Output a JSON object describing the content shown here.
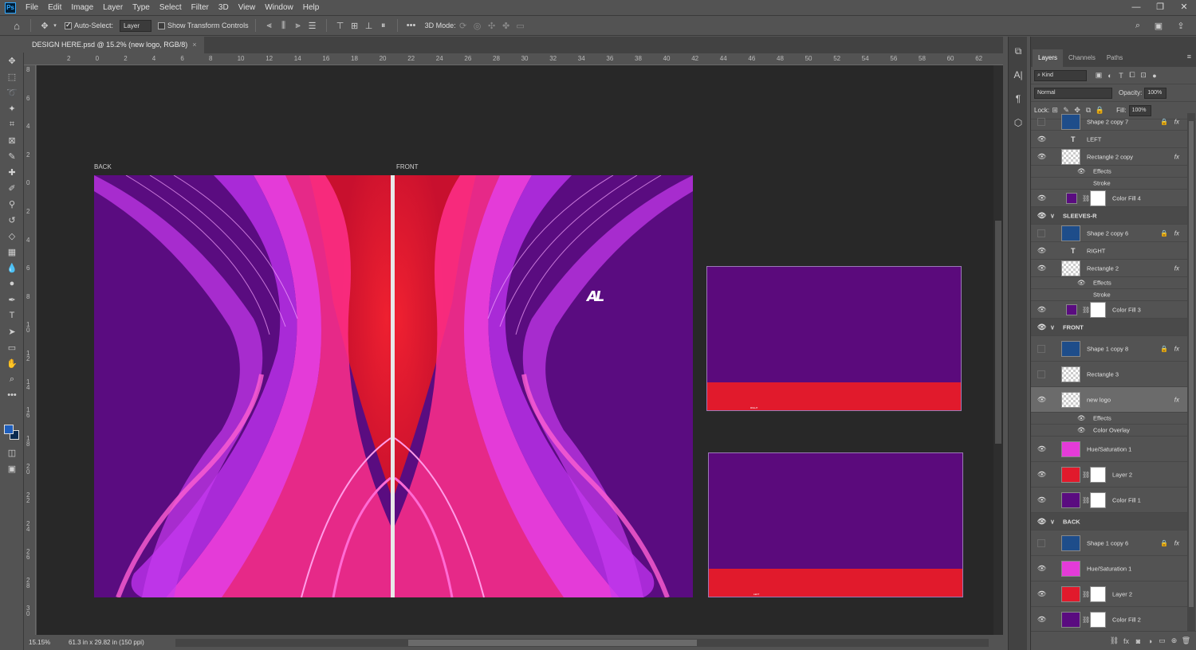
{
  "app": {
    "logo": "Ps"
  },
  "menu": [
    "File",
    "Edit",
    "Image",
    "Layer",
    "Type",
    "Select",
    "Filter",
    "3D",
    "View",
    "Window",
    "Help"
  ],
  "window_controls": [
    "—",
    "❐",
    "✕"
  ],
  "options": {
    "auto_select_label": "Auto-Select:",
    "target_value": "Layer",
    "show_transform_label": "Show Transform Controls",
    "mode_3d_label": "3D Mode:"
  },
  "document": {
    "tab_title": "DESIGN HERE.psd @ 15.2% (new logo, RGB/8)",
    "close": "×"
  },
  "ruler_h": [
    "2",
    "0",
    "2",
    "4",
    "6",
    "8",
    "10",
    "12",
    "14",
    "16",
    "18",
    "20",
    "22",
    "24",
    "26",
    "28",
    "30",
    "32",
    "34",
    "36",
    "38",
    "40",
    "42",
    "44",
    "46",
    "48",
    "50",
    "52",
    "54",
    "56",
    "58",
    "60",
    "62"
  ],
  "ruler_v": [
    "8",
    "6",
    "4",
    "2",
    "0",
    "2",
    "4",
    "6",
    "8",
    "1 0",
    "1 2",
    "1 4",
    "1 6",
    "1 8",
    "2 0",
    "2 2",
    "2 4",
    "2 6",
    "2 8",
    "3 0"
  ],
  "canvas": {
    "back_label": "BACK",
    "front_label": "FRONT",
    "logo_text": "AL",
    "sleeve_right_text": "RIGHT",
    "sleeve_left_text": "LEFT",
    "colors": {
      "purple": "#5a0c80",
      "red": "#e11a2c",
      "magenta": "#e43bd8",
      "pink": "#ff3c8e"
    }
  },
  "status": {
    "zoom": "15.15%",
    "info": "61.3 in x 29.82 in (150 ppi)"
  },
  "layers_panel": {
    "tabs": [
      "Layers",
      "Channels",
      "Paths"
    ],
    "filter_kind": "Kind",
    "blend_mode": "Normal",
    "opacity_label": "Opacity:",
    "opacity_value": "100%",
    "lock_label": "Lock:",
    "fill_label": "Fill:",
    "fill_value": "100%",
    "rows": [
      {
        "kind": "layer",
        "name": "Shape 2 copy 7",
        "visible": false,
        "lock": true,
        "fx": true,
        "thumb": "#1e4d8a"
      },
      {
        "kind": "type",
        "name": "LEFT",
        "visible": true
      },
      {
        "kind": "layer",
        "name": "Rectangle 2 copy",
        "visible": true,
        "fx": true,
        "thumb": "checker"
      },
      {
        "kind": "effects",
        "name": "Effects"
      },
      {
        "kind": "effect",
        "name": "Stroke"
      },
      {
        "kind": "fill",
        "name": "Color Fill 4",
        "visible": true,
        "thumb": "#5a0c80"
      },
      {
        "kind": "group",
        "name": "SLEEVES-R",
        "visible": true
      },
      {
        "kind": "layer",
        "name": "Shape 2 copy 6",
        "visible": false,
        "lock": true,
        "fx": true,
        "thumb": "#1e4d8a"
      },
      {
        "kind": "type",
        "name": "RIGHT",
        "visible": true
      },
      {
        "kind": "layer",
        "name": "Rectangle 2",
        "visible": true,
        "fx": true,
        "thumb": "checker"
      },
      {
        "kind": "effects",
        "name": "Effects"
      },
      {
        "kind": "effect",
        "name": "Stroke"
      },
      {
        "kind": "fill",
        "name": "Color Fill 3",
        "visible": true,
        "thumb": "#5a0c80"
      },
      {
        "kind": "group",
        "name": "FRONT",
        "visible": true
      },
      {
        "kind": "tall",
        "name": "Shape 1 copy 8",
        "visible": false,
        "lock": true,
        "fx": true,
        "thumb": "#1e4d8a"
      },
      {
        "kind": "tall",
        "name": "Rectangle 3",
        "visible": false,
        "thumb": "checker"
      },
      {
        "kind": "tall",
        "name": "new logo",
        "visible": true,
        "fx": true,
        "thumb": "checker",
        "selected": true
      },
      {
        "kind": "effects",
        "name": "Effects"
      },
      {
        "kind": "effect-eye",
        "name": "Color Overlay"
      },
      {
        "kind": "tall",
        "name": "Hue/Saturation 1",
        "visible": true,
        "thumb": "#e43bd8"
      },
      {
        "kind": "tallmask",
        "name": "Layer 2",
        "visible": true,
        "thumb": "#e11a2c"
      },
      {
        "kind": "tallmask",
        "name": "Color Fill 1",
        "visible": true,
        "thumb": "#5a0c80"
      },
      {
        "kind": "group",
        "name": "BACK",
        "visible": true
      },
      {
        "kind": "tall",
        "name": "Shape 1 copy 6",
        "visible": false,
        "lock": true,
        "fx": true,
        "thumb": "#1e4d8a"
      },
      {
        "kind": "tall",
        "name": "Hue/Saturation 1",
        "visible": true,
        "thumb": "#e43bd8"
      },
      {
        "kind": "tallmask",
        "name": "Layer 2",
        "visible": true,
        "thumb": "#e11a2c"
      },
      {
        "kind": "tallmask",
        "name": "Color Fill 2",
        "visible": true,
        "thumb": "#5a0c80"
      }
    ]
  }
}
